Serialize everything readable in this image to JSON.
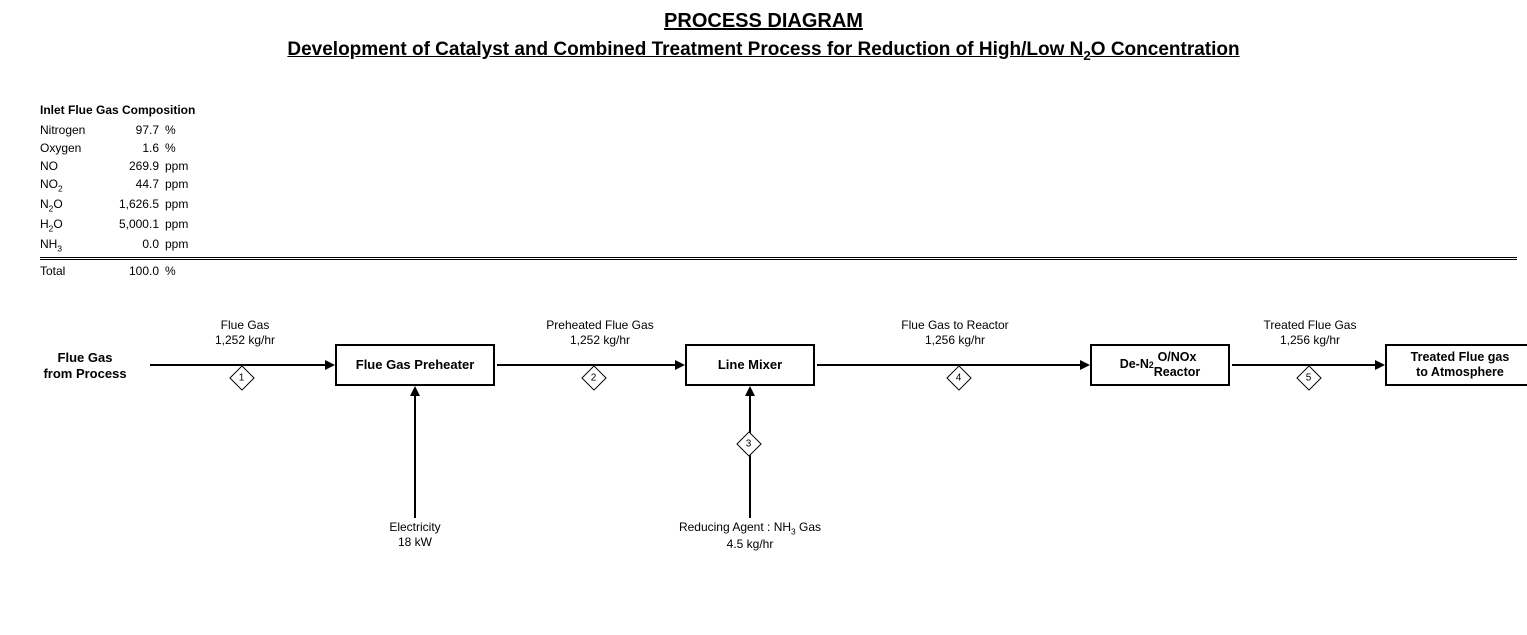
{
  "title": "PROCESS DIAGRAM",
  "subtitle_html": "Development of Catalyst and Combined Treatment Process for Reduction of High/Low N<sub>2</sub>O Concentration",
  "composition": {
    "title": "Inlet Flue Gas Composition",
    "rows": [
      {
        "name_html": "Nitrogen",
        "value": "97.7",
        "unit": "%"
      },
      {
        "name_html": "Oxygen",
        "value": "1.6",
        "unit": "%"
      },
      {
        "name_html": "NO",
        "value": "269.9",
        "unit": "ppm"
      },
      {
        "name_html": "NO<sub>2</sub>",
        "value": "44.7",
        "unit": "ppm"
      },
      {
        "name_html": "N<sub>2</sub>O",
        "value": "1,626.5",
        "unit": "ppm"
      },
      {
        "name_html": "H<sub>2</sub>O",
        "value": "5,000.1",
        "unit": "ppm"
      },
      {
        "name_html": "NH<sub>3</sub>",
        "value": "0.0",
        "unit": "ppm"
      }
    ],
    "total": {
      "name": "Total",
      "value": "100.0",
      "unit": "%"
    }
  },
  "diagram": {
    "source_html": "Flue Gas<br>from Process",
    "boxes": {
      "preheater": "Flue Gas Preheater",
      "mixer": "Line Mixer",
      "reactor_html": "De-N<sub>2</sub>O/NOx<br>Reactor",
      "sink_html": "Treated Flue gas<br>to Atmosphere"
    },
    "streams": {
      "s1": {
        "num": "1",
        "label_html": "Flue Gas<br>1,252 kg/hr"
      },
      "s2": {
        "num": "2",
        "label_html": "Preheated Flue Gas<br>1,252 kg/hr"
      },
      "s3": {
        "num": "3",
        "label_html": "Reducing Agent : NH<sub>3</sub> Gas<br>4.5 kg/hr"
      },
      "s4": {
        "num": "4",
        "label_html": "Flue Gas to Reactor<br>1,256 kg/hr"
      },
      "s5": {
        "num": "5",
        "label_html": "Treated Flue Gas<br>1,256 kg/hr"
      }
    },
    "inputs": {
      "electricity_html": "Electricity<br>18 kW"
    }
  }
}
